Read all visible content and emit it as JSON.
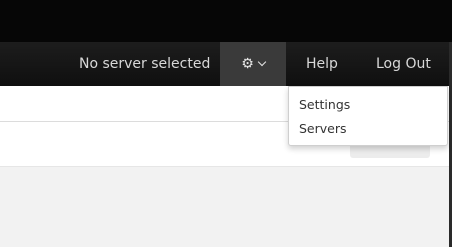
{
  "navbar": {
    "server_status": "No server selected",
    "settings_icon": "gear-icon",
    "settings_chevron_icon": "chevron-down-icon",
    "help_label": "Help",
    "logout_label": "Log Out"
  },
  "settings_menu": {
    "items": [
      {
        "label": "Settings"
      },
      {
        "label": "Servers"
      }
    ]
  },
  "colors": {
    "navbar_bg": "#141414",
    "active_toggle_bg": "#3a3a3a",
    "nav_text": "#d8d8d8",
    "page_bg": "#f2f2f2"
  }
}
